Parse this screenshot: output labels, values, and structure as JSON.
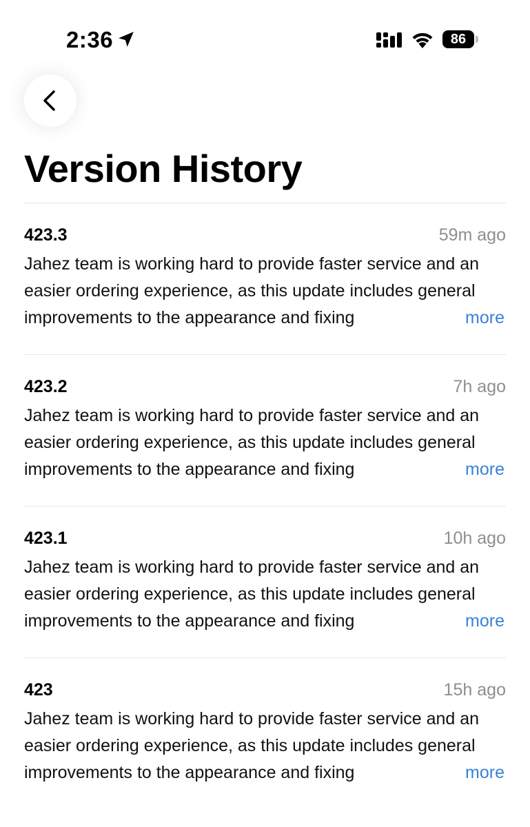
{
  "status_bar": {
    "time": "2:36",
    "battery_level": "86",
    "icons": [
      "location-arrow-icon",
      "cellular-signal-icon",
      "wifi-icon",
      "battery-icon"
    ]
  },
  "header": {
    "back_icon": "chevron-left-icon",
    "title": "Version History"
  },
  "colors": {
    "accent": "#3a82d6",
    "secondary_text": "#8e8e93",
    "divider": "#e6e6e6"
  },
  "versions": [
    {
      "number": "423.3",
      "time": "59m ago",
      "notes": "Jahez team is working hard to provide faster service and an easier ordering experience, as this update includes general improvements to the appearance and fixing",
      "more_label": "more"
    },
    {
      "number": "423.2",
      "time": "7h ago",
      "notes": "Jahez team is working hard to provide faster service and an easier ordering experience, as this update includes general improvements to the appearance and fixing",
      "more_label": "more"
    },
    {
      "number": "423.1",
      "time": "10h ago",
      "notes": "Jahez team is working hard to provide faster service and an easier ordering experience, as this update includes general improvements to the appearance and fixing",
      "more_label": "more"
    },
    {
      "number": "423",
      "time": "15h ago",
      "notes": "Jahez team is working hard to provide faster service and an easier ordering experience, as this update includes general improvements to the appearance and fixing",
      "more_label": "more"
    }
  ]
}
